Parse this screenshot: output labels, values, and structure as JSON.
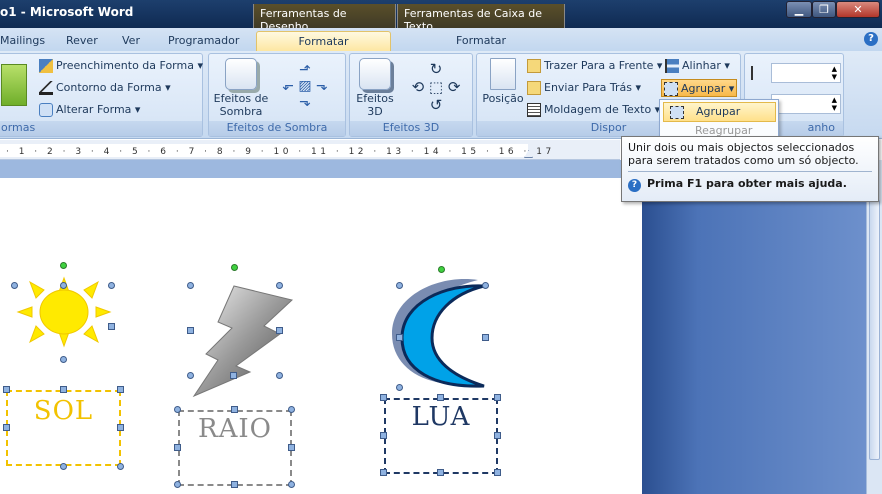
{
  "titlebar": {
    "title": "o1 - Microsoft Word",
    "context_tab_1": "Ferramentas de Desenho",
    "context_tab_2": "Ferramentas de Caixa de Texto"
  },
  "tabs": {
    "mailings": "Mailings",
    "rever": "Rever",
    "ver": "Ver",
    "programador": "Programador",
    "formatar_draw": "Formatar",
    "formatar_text": "Formatar"
  },
  "ribbon": {
    "preenchimento": "Preenchimento da Forma",
    "contorno": "Contorno da Forma",
    "alterar": "Alterar Forma",
    "formas_group": "ormas",
    "efeitos_sombra_1": "Efeitos de",
    "efeitos_sombra_2": "Sombra",
    "sombra_group": "Efeitos de Sombra",
    "efeitos3d_1": "Efeitos",
    "efeitos3d_2": "3D",
    "efeitos3d_group": "Efeitos 3D",
    "posicao": "Posição",
    "trazer": "Trazer Para a Frente",
    "enviar": "Enviar Para Trás",
    "moldagem": "Moldagem de Texto",
    "alinhar": "Alinhar",
    "agrupar": "Agrupar",
    "dispor_group": "Dispor",
    "tamanho_group": "anho"
  },
  "dropdown": {
    "item1": "Agrupar",
    "item2": "Reagrupar"
  },
  "tooltip": {
    "line1": "Unir dois ou mais objectos seleccionados",
    "line2": "para serem tratados como um só objecto.",
    "help": "Prima F1 para obter mais ajuda."
  },
  "ruler": {
    "ticks": "· 1 · 2 · 3 · 4 · 5 · 6 · 7 · 8 · 9 · 10 · 11 · 12 · 13 · 14 · 15 · 16 · 17"
  },
  "document": {
    "label_sol": "SOL",
    "label_raio": "RAIO",
    "label_lua": "LUA"
  },
  "colors": {
    "sun": "#ffea00",
    "sol_text": "#f2c200",
    "raio_text": "#8a8a8a",
    "lua_text": "#1f3864",
    "moon_fill": "#00a2e8"
  }
}
